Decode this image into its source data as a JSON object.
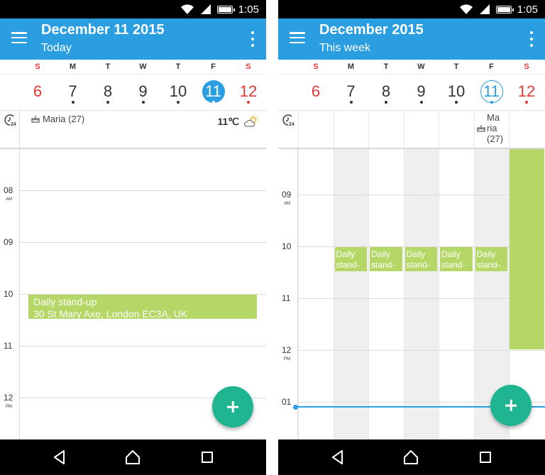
{
  "status": {
    "time": "1:05"
  },
  "left": {
    "title": "December 11 2015",
    "subtitle": "Today",
    "days": [
      {
        "letter": "S",
        "num": "6"
      },
      {
        "letter": "M",
        "num": "7"
      },
      {
        "letter": "T",
        "num": "8"
      },
      {
        "letter": "W",
        "num": "9"
      },
      {
        "letter": "T",
        "num": "10"
      },
      {
        "letter": "F",
        "num": "11"
      },
      {
        "letter": "S",
        "num": "12"
      }
    ],
    "birthday": "Maria (27)",
    "weather_temp": "11℃",
    "hours": [
      {
        "h": "08",
        "ampm": "AM"
      },
      {
        "h": "09",
        "ampm": ""
      },
      {
        "h": "10",
        "ampm": ""
      },
      {
        "h": "11",
        "ampm": ""
      },
      {
        "h": "12",
        "ampm": "PM"
      }
    ],
    "event": {
      "title": "Daily stand-up",
      "location": "30 St Mary Axe, London EC3A, UK"
    }
  },
  "right": {
    "title": "December 2015",
    "subtitle": "This week",
    "days": [
      {
        "letter": "S",
        "num": "6"
      },
      {
        "letter": "M",
        "num": "7"
      },
      {
        "letter": "T",
        "num": "8"
      },
      {
        "letter": "W",
        "num": "9"
      },
      {
        "letter": "T",
        "num": "10"
      },
      {
        "letter": "F",
        "num": "11"
      },
      {
        "letter": "S",
        "num": "12"
      }
    ],
    "birthday_lines": [
      "Ma",
      "ria",
      "(27)"
    ],
    "hours": [
      {
        "h": "09",
        "ampm": "AM"
      },
      {
        "h": "10",
        "ampm": ""
      },
      {
        "h": "11",
        "ampm": ""
      },
      {
        "h": "12",
        "ampm": "PM"
      },
      {
        "h": "01",
        "ampm": ""
      }
    ],
    "events": [
      {
        "line1": "Daily",
        "line2": "stand-up"
      },
      {
        "line1": "Daily",
        "line2": "stand-up"
      },
      {
        "line1": "Daily",
        "line2": "stand-up"
      },
      {
        "line1": "Daily",
        "line2": "stand-up"
      },
      {
        "line1": "Daily",
        "line2": "stand-up"
      }
    ]
  },
  "icons": {
    "menu": "hamburger-icon",
    "overflow": "more-vert-icon",
    "clock24": "clock-24-icon",
    "cake": "cake-icon",
    "weather": "partly-cloudy-icon",
    "fab": "plus-icon",
    "back": "back-triangle-icon",
    "home": "home-icon",
    "recents": "recents-square-icon"
  },
  "colors": {
    "appbar": "#2a9ee0",
    "event": "#b5d767",
    "fab": "#1fb590",
    "weekend": "#e53935"
  }
}
